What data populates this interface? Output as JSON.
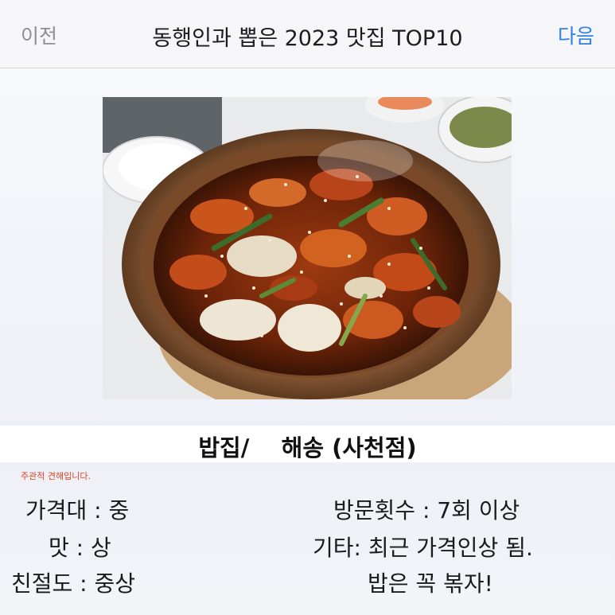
{
  "nav": {
    "prev_label": "이전",
    "title": "동행인과 뽑은 2023 맛집 TOP10",
    "next_label": "다음"
  },
  "photo": {
    "icon": "spicy-stir-fried-chicken-photo"
  },
  "place": {
    "name": "밥집/    해송 (사천점)"
  },
  "disclaimer": "주관적 견해입니다.",
  "info_left": {
    "price": "가격대 : 중",
    "taste": "맛 : 상",
    "kindness": "친절도 : 중상"
  },
  "info_right": {
    "visits": "방문횟수 : 7회 이상",
    "etc_line1": "기타: 최근 가격인상 됨.",
    "etc_line2": "밥은 꼭 볶자!"
  },
  "colors": {
    "accent": "#2f7fe8",
    "disclaimer": "#e0401f"
  }
}
